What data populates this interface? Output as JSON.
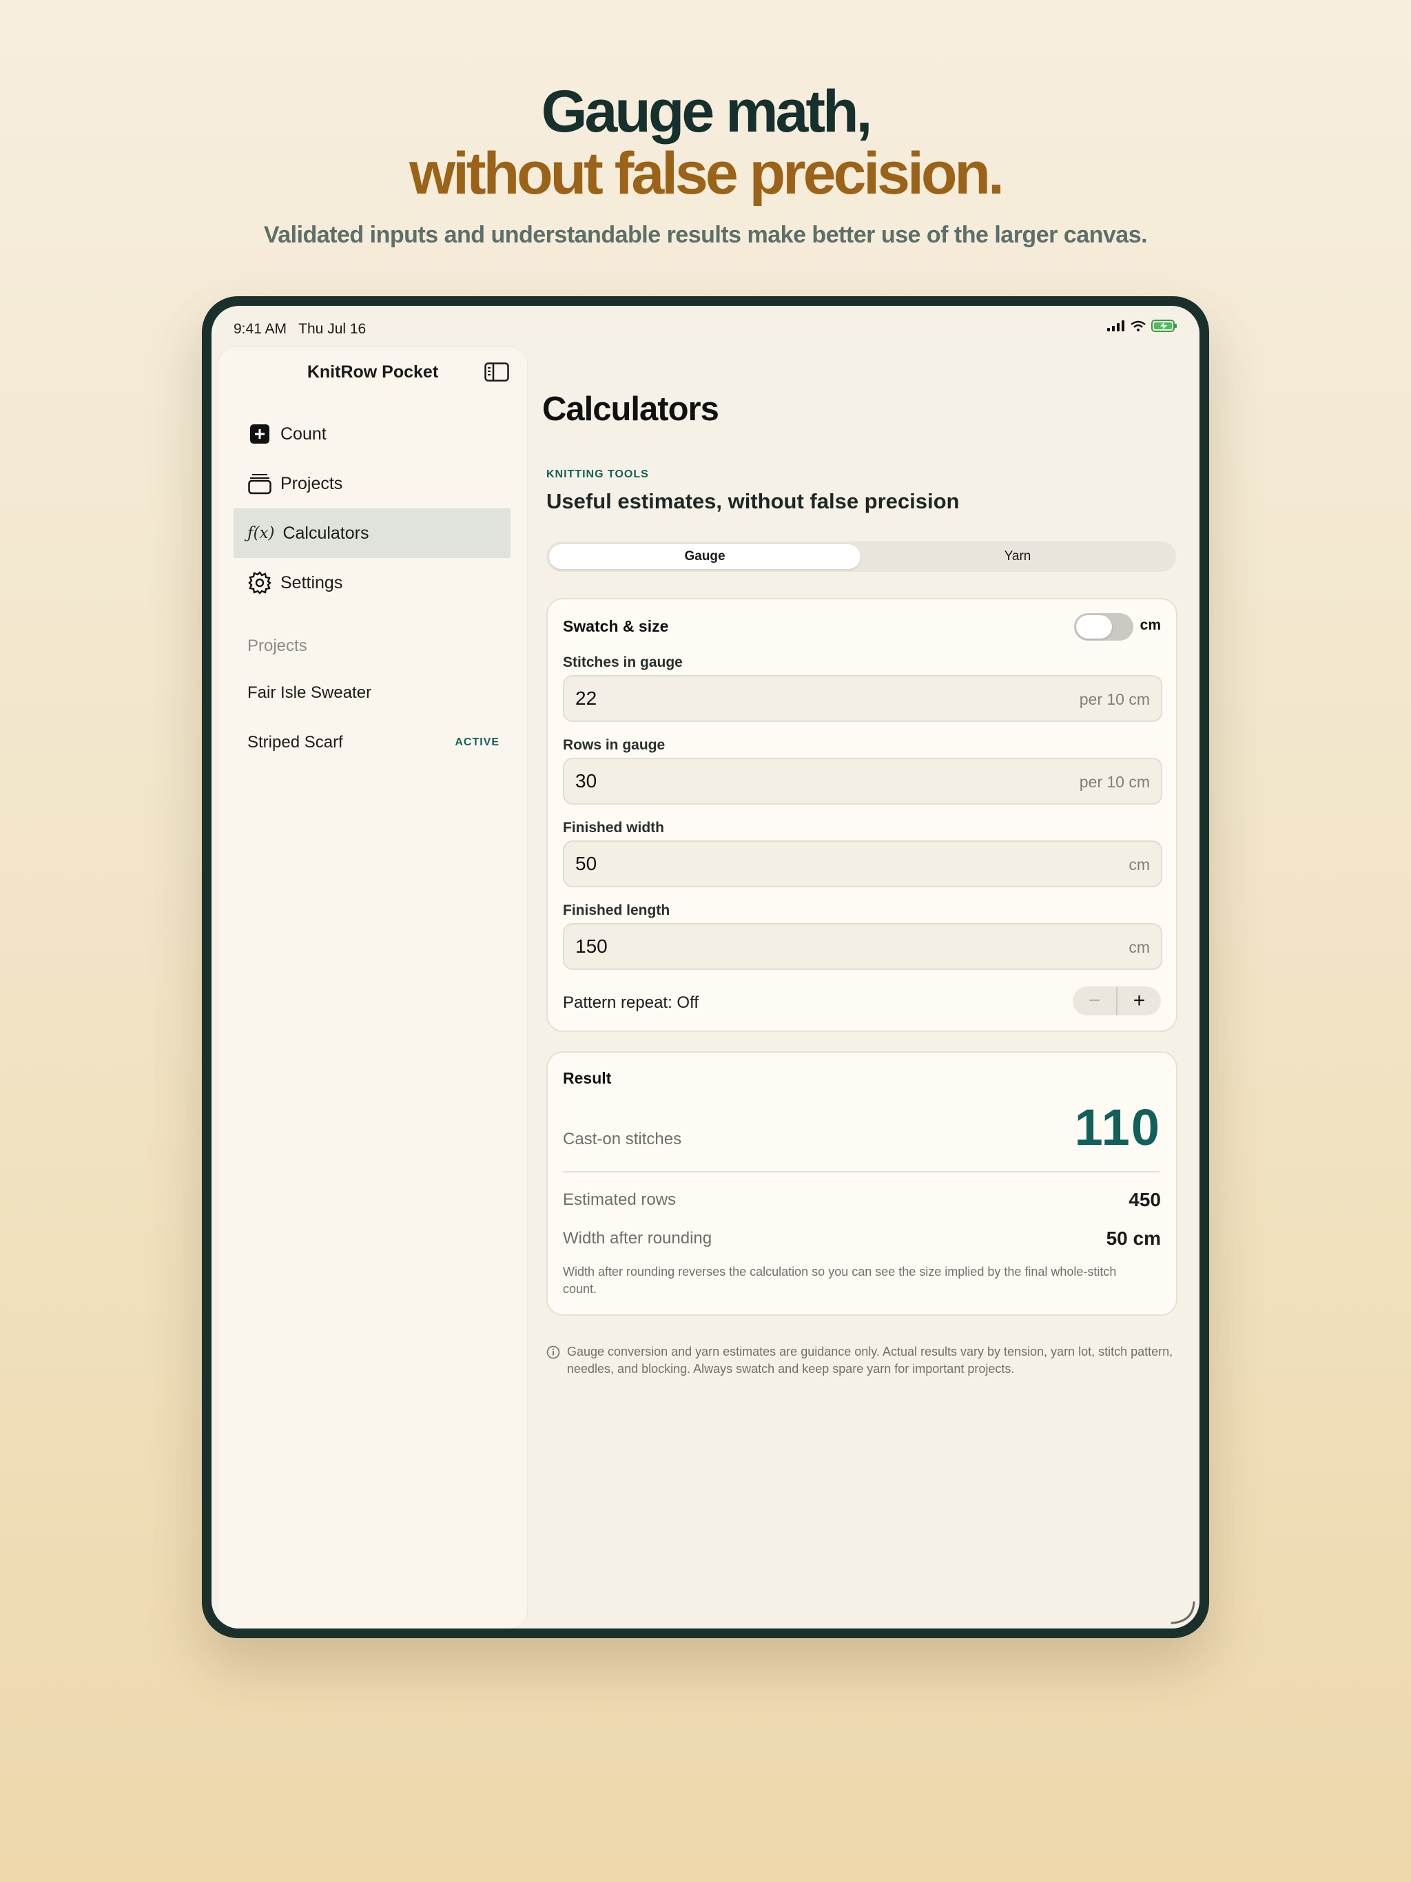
{
  "hero": {
    "line1": "Gauge math,",
    "line2": "without false precision.",
    "subtitle": "Validated inputs and understandable results make better use of the larger canvas."
  },
  "status": {
    "time": "9:41 AM   Thu Jul 16"
  },
  "sidebar": {
    "title": "KnitRow Pocket",
    "items": [
      {
        "label": "Count",
        "icon": "plus-square-icon"
      },
      {
        "label": "Projects",
        "icon": "folder-stack-icon"
      },
      {
        "label": "Calculators",
        "icon": "function-icon",
        "selected": true
      },
      {
        "label": "Settings",
        "icon": "gear-icon"
      }
    ],
    "section_label": "Projects",
    "projects": [
      {
        "name": "Fair Isle Sweater",
        "badge": ""
      },
      {
        "name": "Striped Scarf",
        "badge": "ACTIVE"
      }
    ]
  },
  "main": {
    "title": "Calculators",
    "eyebrow": "KNITTING TOOLS",
    "subhead": "Useful estimates, without false precision",
    "tabs": [
      {
        "label": "Gauge",
        "active": true
      },
      {
        "label": "Yarn",
        "active": false
      }
    ],
    "swatch": {
      "header": "Swatch & size",
      "unit_toggle_label": "cm",
      "unit_toggle_on": false,
      "fields": [
        {
          "label": "Stitches in gauge",
          "value": "22",
          "unit": "per 10 cm"
        },
        {
          "label": "Rows in gauge",
          "value": "30",
          "unit": "per 10 cm"
        },
        {
          "label": "Finished width",
          "value": "50",
          "unit": "cm"
        },
        {
          "label": "Finished length",
          "value": "150",
          "unit": "cm"
        }
      ],
      "pattern_repeat": "Pattern repeat: Off",
      "stepper_minus": "−",
      "stepper_plus": "+"
    },
    "result": {
      "header": "Result",
      "cast_on_label": "Cast-on stitches",
      "cast_on_value": "110",
      "rows_label": "Estimated rows",
      "rows_value": "450",
      "width_label": "Width after rounding",
      "width_value": "50 cm",
      "note": "Width after rounding reverses the calculation so you can see the size implied by the final whole-stitch count."
    },
    "disclaimer": "Gauge conversion and yarn estimates are guidance only. Actual results vary by tension, yarn lot, stitch pattern, needles, and blocking. Always swatch and keep spare yarn for important projects."
  },
  "colors": {
    "accent_teal": "#13605a",
    "hero_gold": "#9a6317",
    "device_frame": "#1a302c"
  }
}
